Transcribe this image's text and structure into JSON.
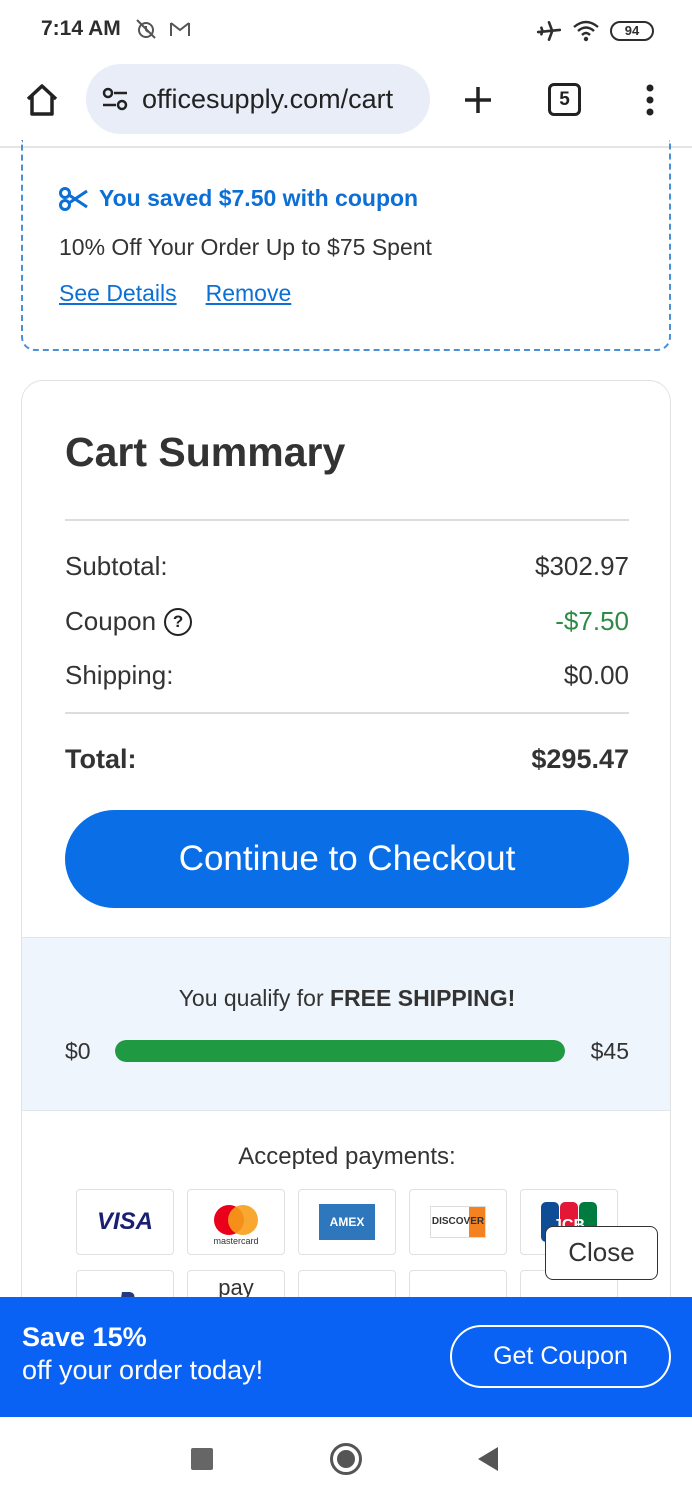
{
  "status_bar": {
    "time": "7:14 AM",
    "battery": "94",
    "icons": [
      "alarm-off-icon",
      "gmail-icon",
      "airplane-icon",
      "wifi-icon",
      "battery-icon"
    ]
  },
  "browser": {
    "url": "officesupply.com/cart",
    "tab_count": "5"
  },
  "coupon": {
    "heading": "You saved $7.50 with coupon",
    "description": "10% Off Your Order Up to $75 Spent",
    "see_details": "See Details",
    "remove": "Remove",
    "accent_color": "#0b6fd6"
  },
  "summary": {
    "title": "Cart Summary",
    "subtotal_label": "Subtotal:",
    "subtotal_value": "$302.97",
    "coupon_label": "Coupon",
    "coupon_help": "?",
    "coupon_value": "-$7.50",
    "shipping_label": "Shipping:",
    "shipping_value": "$0.00",
    "total_label": "Total:",
    "total_value": "$295.47",
    "checkout_label": "Continue to Checkout"
  },
  "free_shipping": {
    "prefix": "You qualify for ",
    "emphasis": "FREE SHIPPING!",
    "min_label": "$0",
    "max_label": "$45",
    "progress": 1.0
  },
  "payments": {
    "title": "Accepted payments:",
    "row1": [
      "VISA",
      "mastercard",
      "AMEX",
      "DISCOVER",
      "JCB"
    ],
    "row2_partial": [
      "PayPal",
      "pay",
      "",
      "",
      ""
    ]
  },
  "overlay": {
    "close_label": "Close"
  },
  "promo": {
    "title": "Save 15%",
    "subtitle": "off your order today!",
    "button": "Get Coupon"
  }
}
